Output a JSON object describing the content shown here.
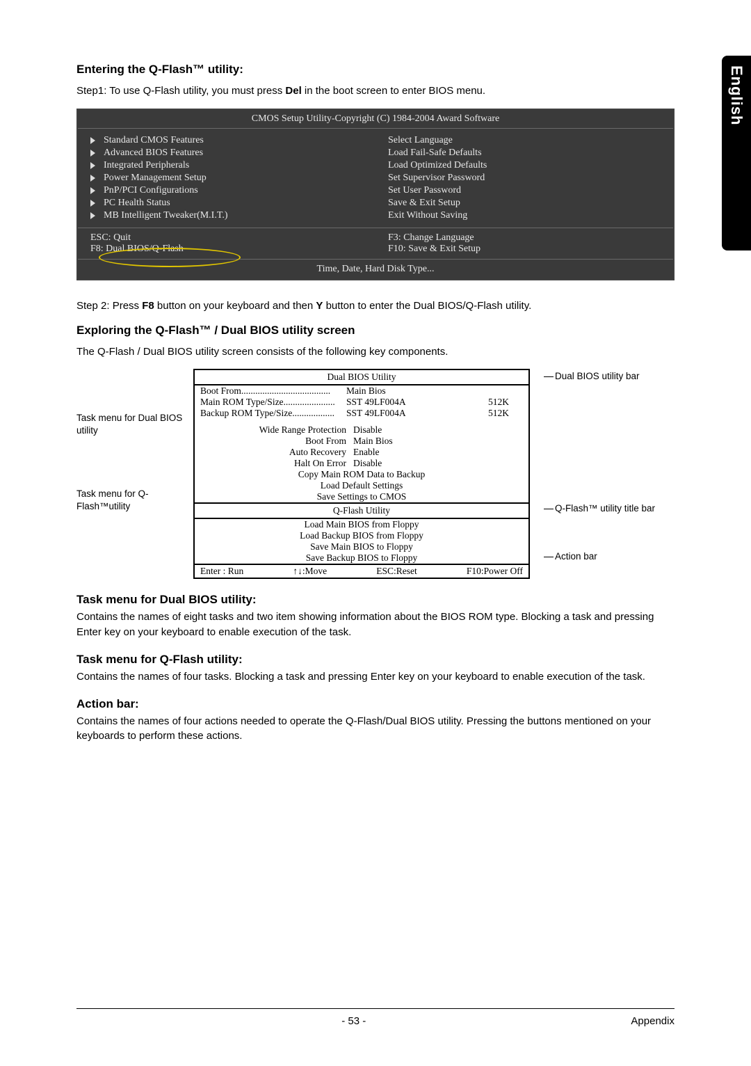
{
  "side_tab": "English",
  "section1": {
    "title": "Entering the Q-Flash™ utility:",
    "step1_a": "Step1: To use Q-Flash utility, you must press ",
    "step1_b": "Del",
    "step1_c": " in the boot screen to enter BIOS menu."
  },
  "bios": {
    "title": "CMOS Setup Utility-Copyright (C) 1984-2004 Award Software",
    "left": [
      "Standard CMOS Features",
      "Advanced BIOS Features",
      "Integrated Peripherals",
      "Power Management Setup",
      "PnP/PCI Configurations",
      "PC Health Status",
      "MB Intelligent Tweaker(M.I.T.)"
    ],
    "right": [
      "Select Language",
      "Load Fail-Safe Defaults",
      "Load Optimized Defaults",
      "Set Supervisor Password",
      "Set User Password",
      "Save & Exit Setup",
      "Exit Without Saving"
    ],
    "foot_l1": "ESC: Quit",
    "foot_l2": "F8: Dual BIOS/Q-Flash",
    "foot_r1": "F3: Change Language",
    "foot_r2": "F10: Save & Exit Setup",
    "status": "Time, Date, Hard Disk Type..."
  },
  "step2": {
    "a": "Step 2: Press ",
    "b": "F8",
    "c": " button on your keyboard and then ",
    "d": "Y",
    "e": " button to enter the Dual BIOS/Q-Flash utility."
  },
  "section2": {
    "title": "Exploring the Q-Flash™ / Dual BIOS utility screen",
    "intro": "The Q-Flash / Dual BIOS utility screen consists of the following key components."
  },
  "diagram": {
    "left_label1": "Task menu for Dual BIOS utility",
    "left_label2": "Task menu for Q-Flash™utility",
    "right_label1": "Dual BIOS utility bar",
    "right_label2": "Q-Flash™ utility title bar",
    "right_label3": "Action bar",
    "title1": "Dual BIOS Utility",
    "info": [
      {
        "l": "Boot From......................................",
        "v": "Main Bios",
        "s": ""
      },
      {
        "l": "Main ROM Type/Size......................",
        "v": "SST 49LF004A",
        "s": "512K"
      },
      {
        "l": "Backup ROM Type/Size..................",
        "v": "SST 49LF004A",
        "s": "512K"
      }
    ],
    "settings": [
      {
        "l": "Wide Range Protection",
        "v": "Disable"
      },
      {
        "l": "Boot From",
        "v": "Main Bios"
      },
      {
        "l": "Auto Recovery",
        "v": "Enable"
      },
      {
        "l": "Halt On Error",
        "v": "Disable"
      }
    ],
    "cmds1": [
      "Copy Main ROM Data to Backup",
      "Load Default Settings",
      "Save Settings to CMOS"
    ],
    "title2": "Q-Flash Utility",
    "cmds2": [
      "Load Main BIOS from Floppy",
      "Load Backup BIOS from Floppy",
      "Save Main BIOS to Floppy",
      "Save Backup BIOS to Floppy"
    ],
    "action": {
      "a1": "Enter : Run",
      "a2": "↑↓:Move",
      "a3": "ESC:Reset",
      "a4": "F10:Power Off"
    }
  },
  "sections": {
    "t1": "Task menu for Dual BIOS utility:",
    "p1": "Contains the names of eight tasks and two item showing information about the BIOS ROM type. Blocking a task and pressing Enter key on your keyboard to enable execution of the task.",
    "t2": "Task menu for Q-Flash utility:",
    "p2": "Contains the names of four tasks. Blocking a task and pressing Enter key on your keyboard to enable execution of the task.",
    "t3": "Action bar:",
    "p3": "Contains the names of four actions needed to operate the Q-Flash/Dual BIOS utility. Pressing the buttons mentioned on your keyboards to perform these actions."
  },
  "footer": {
    "page": "- 53 -",
    "section": "Appendix"
  }
}
